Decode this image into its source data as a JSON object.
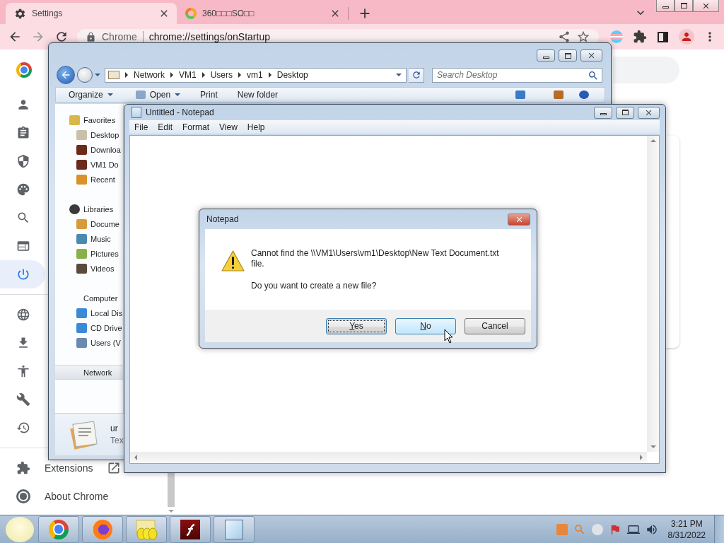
{
  "browser": {
    "tabs": [
      {
        "title": "Settings",
        "selected": true
      },
      {
        "title": "360□□□SO□□",
        "selected": false
      }
    ],
    "address": {
      "origin": "Chrome",
      "url": "chrome://settings/onStartup"
    },
    "sidebar_items": [
      {
        "selected": false
      },
      {
        "selected": false
      },
      {
        "selected": false
      },
      {
        "selected": false
      },
      {
        "selected": false
      },
      {
        "selected": false
      },
      {
        "selected": true
      },
      {
        "selected": false
      },
      {
        "selected": false
      },
      {
        "selected": false
      },
      {
        "selected": false
      },
      {
        "selected": false
      }
    ],
    "sidebar_links": [
      {
        "label": "Extensions",
        "kind": "external"
      },
      {
        "label": "About Chrome",
        "kind": "page"
      }
    ]
  },
  "explorer": {
    "breadcrumb": [
      "Network",
      "VM1",
      "Users",
      "vm1",
      "Desktop"
    ],
    "search": {
      "placeholder": "Search Desktop"
    },
    "toolbar": [
      {
        "label": "Organize",
        "dropdown": true
      },
      {
        "label": "Open",
        "dropdown": true
      },
      {
        "label": "Print",
        "dropdown": false
      },
      {
        "label": "New folder",
        "dropdown": false
      }
    ],
    "nav_pane": [
      {
        "label": "Favorites",
        "selected": false,
        "children": [
          {
            "label": "Desktop"
          },
          {
            "label": "Downloa"
          },
          {
            "label": "VM1 Do"
          },
          {
            "label": "Recent"
          }
        ]
      },
      {
        "label": "Libraries",
        "selected": false,
        "children": [
          {
            "label": "Docume"
          },
          {
            "label": "Music"
          },
          {
            "label": "Pictures"
          },
          {
            "label": "Videos"
          }
        ]
      },
      {
        "label": "Computer",
        "selected": false,
        "children": [
          {
            "label": "Local Dis"
          },
          {
            "label": "CD Drive"
          },
          {
            "label": "Users (V"
          }
        ]
      },
      {
        "label": "Network",
        "selected": true
      }
    ],
    "details": {
      "name": "ur",
      "type": "Tex"
    }
  },
  "notepad": {
    "title": "Untitled - Notepad",
    "menu": [
      "File",
      "Edit",
      "Format",
      "View",
      "Help"
    ]
  },
  "dialog": {
    "title": "Notepad",
    "message": "Cannot find the \\\\VM1\\Users\\vm1\\Desktop\\New Text Document.txt file.",
    "question": "Do you want to create a new file?",
    "buttons": [
      {
        "label": "Yes",
        "mnemonic": true,
        "focused": true,
        "hovered": false
      },
      {
        "label": "No",
        "mnemonic": true,
        "focused": false,
        "hovered": true
      },
      {
        "label": "Cancel",
        "mnemonic": false,
        "focused": false,
        "hovered": false
      }
    ]
  },
  "taskbar": {
    "time": "3:21 PM",
    "date": "8/31/2022"
  }
}
